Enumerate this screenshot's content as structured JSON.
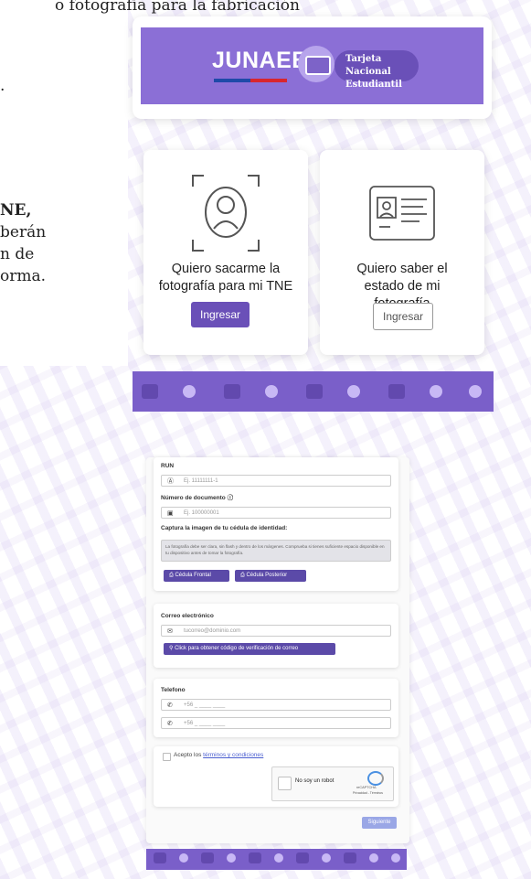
{
  "intro": {
    "line1": "o fotografía para la fabricación",
    "line2": ".",
    "line3": "NE,",
    "line4": "berán",
    "line5": "n de",
    "line6": "orma."
  },
  "logo": {
    "brand": "JUNAEB",
    "tne_line1": "Tarjeta Nacional",
    "tne_line2": "Estudiantil"
  },
  "choices": [
    {
      "title": "Quiero sacarme la fotografía para mi TNE",
      "button": "Ingresar",
      "icon": "face-scan-icon"
    },
    {
      "title": "Quiero saber el estado de mi fotografía",
      "button": "Ingresar",
      "icon": "id-card-icon"
    }
  ],
  "form": {
    "run_label": "RUN",
    "run_placeholder": "Ej. 11111111-1",
    "doc_label": "Número de documento ⓘ",
    "doc_placeholder": "Ej. 100000001",
    "capture_label": "Captura la imagen de tu cédula de identidad:",
    "note_text": "La fotografía debe ser clara, sin flash y dentro de los márgenes. Comprueba si tienes suficiente espacio disponible en tu dispositivo antes de tomar la fotografía.",
    "front_button": "Cédula Frontal",
    "back_button": "Cédula Posterior",
    "email_label": "Correo electrónico",
    "email_placeholder": "tucorreo@dominio.com",
    "verify_button": "Click para obtener código de verificación de correo",
    "phone_label": "Telefono",
    "phone1_placeholder": "+56 _ ____ ____",
    "phone2_placeholder": "+56 _ ____ ____",
    "terms_prefix": "Acepto los",
    "terms_link": "términos y condiciones",
    "captcha_text": "No soy un robot",
    "captcha_brand": "reCAPTCHA",
    "captcha_links": "Privacidad - Términos",
    "next_button": "Siguiente"
  },
  "colors": {
    "primary": "#6a50b8",
    "band": "#8b6fd6",
    "strip": "#7a5fc9"
  }
}
